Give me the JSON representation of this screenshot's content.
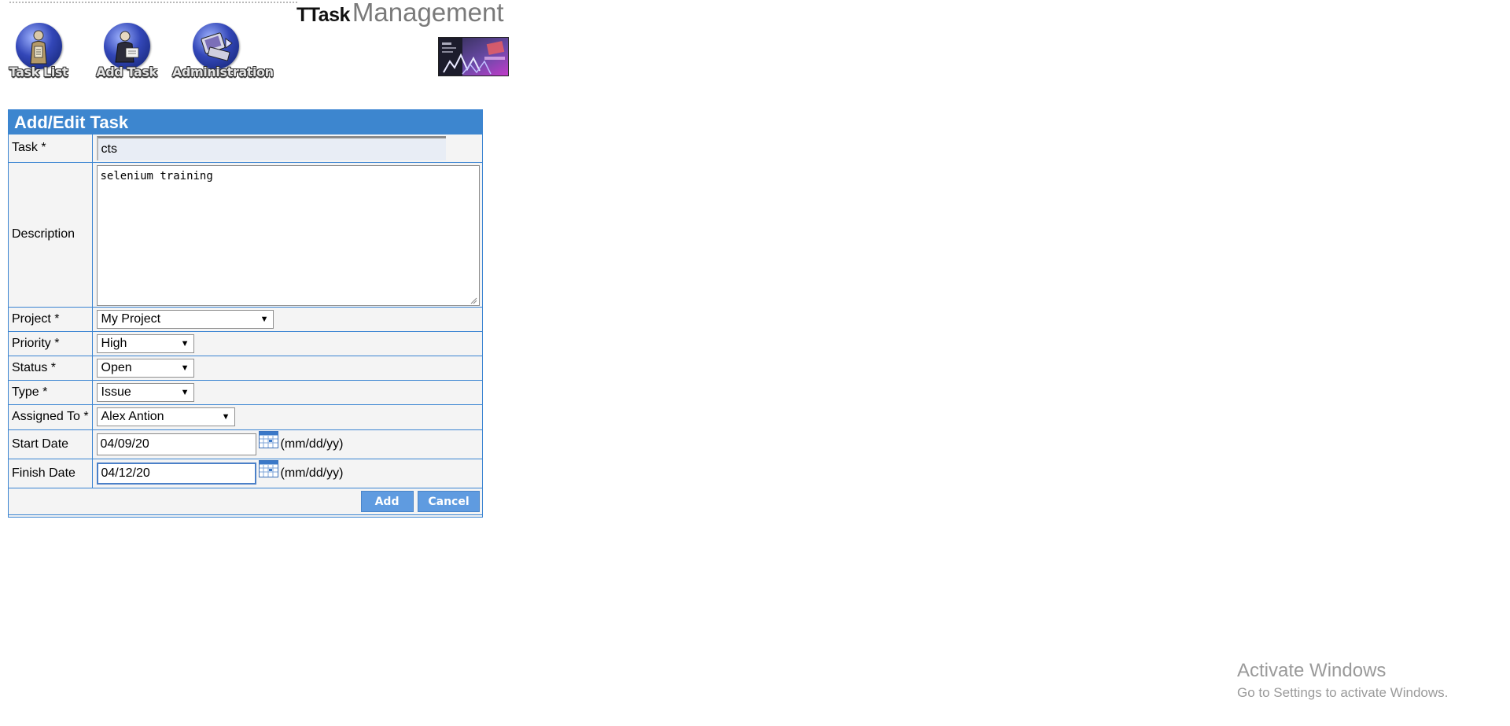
{
  "header": {
    "logo_part1": "TTask",
    "logo_part2": "Management"
  },
  "nav": [
    {
      "label": "Task List",
      "icon": "task-list-icon"
    },
    {
      "label": "Add Task",
      "icon": "add-task-icon"
    },
    {
      "label": "Administration",
      "icon": "administration-icon"
    }
  ],
  "form": {
    "title": "Add/Edit Task",
    "task_label": "Task *",
    "task_value": "cts",
    "description_label": "Description",
    "description_value": "selenium training",
    "project_label": "Project *",
    "project_value": "My Project",
    "priority_label": "Priority *",
    "priority_value": "High",
    "status_label": "Status *",
    "status_value": "Open",
    "type_label": "Type *",
    "type_value": "Issue",
    "assigned_label": "Assigned To *",
    "assigned_value": "Alex Antion",
    "start_label": "Start Date",
    "start_value": "04/09/20",
    "finish_label": "Finish Date",
    "finish_value": "04/12/20",
    "date_hint": "(mm/dd/yy)",
    "add_button": "Add",
    "cancel_button": "Cancel"
  },
  "watermark": {
    "title": "Activate Windows",
    "subtitle": "Go to Settings to activate Windows."
  },
  "colors": {
    "panel_border": "#3a84d2",
    "title_bar": "#3d86cf",
    "button": "#5f9be0"
  }
}
